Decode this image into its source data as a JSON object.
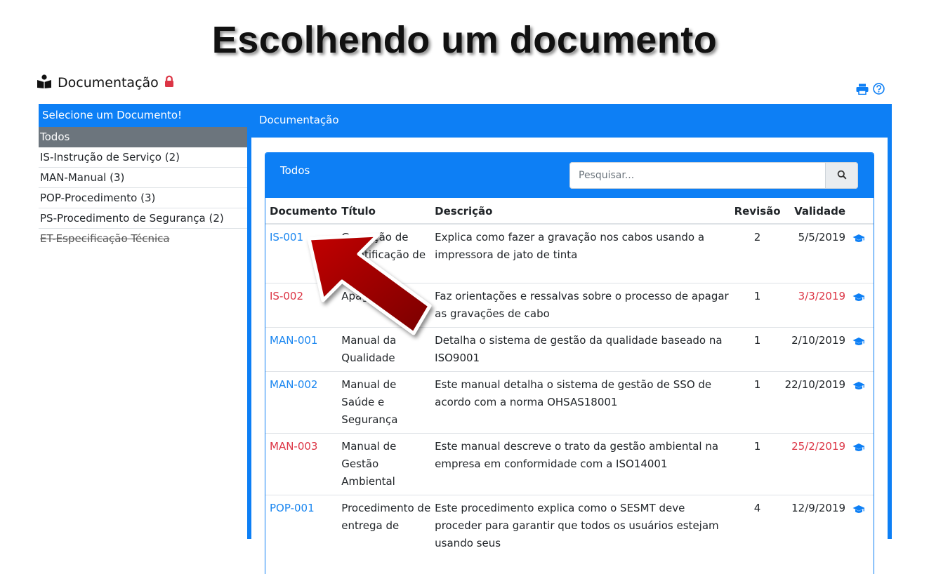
{
  "slide_title": "Escolhendo um documento",
  "page_header": {
    "title": "Documentação",
    "icon": "reader-icon",
    "lock_icon": "lock-icon"
  },
  "tools": {
    "print_icon": "print-icon",
    "help_icon": "help-icon"
  },
  "sidebar": {
    "heading": "Selecione um Documento!",
    "items": [
      {
        "label": "Todos",
        "state": "active"
      },
      {
        "label": "IS-Instrução de Serviço (2)"
      },
      {
        "label": "MAN-Manual (3)"
      },
      {
        "label": "POP-Procedimento (3)"
      },
      {
        "label": "PS-Procedimento de Segurança (2)"
      },
      {
        "label": "ET-Especificação Técnica",
        "state": "strikethrough"
      }
    ]
  },
  "main": {
    "title": "Documentação",
    "sub": {
      "title": "Todos",
      "search": {
        "placeholder": "Pesquisar...",
        "value": ""
      }
    },
    "columns": [
      "Documento",
      "Título",
      "Descrição",
      "Revisão",
      "Validade"
    ],
    "rows": [
      {
        "doc": "IS-001",
        "title": "Gravação de Identificação de",
        "description": "Explica como fazer a gravação nos cabos usando a impressora de jato de tinta",
        "revision": "2",
        "validity": "5/5/2019",
        "expired": false
      },
      {
        "doc": "IS-002",
        "title": "Apagar",
        "description": "Faz orientações e ressalvas sobre o processo de apagar as gravações de cabo",
        "revision": "1",
        "validity": "3/3/2019",
        "expired": true
      },
      {
        "doc": "MAN-001",
        "title": "Manual da Qualidade",
        "description": "Detalha o sistema de gestão da qualidade baseado na ISO9001",
        "revision": "1",
        "validity": "2/10/2019",
        "expired": false
      },
      {
        "doc": "MAN-002",
        "title": "Manual de Saúde e Segurança",
        "description": "Este manual detalha o sistema de gestão de SSO de acordo com a norma OHSAS18001",
        "revision": "1",
        "validity": "22/10/2019",
        "expired": false
      },
      {
        "doc": "MAN-003",
        "title": "Manual de Gestão Ambiental",
        "description": "Este manual descreve o trato da gestão ambiental na empresa em conformidade com a ISO14001",
        "revision": "1",
        "validity": "25/2/2019",
        "expired": true
      },
      {
        "doc": "POP-001",
        "title": "Procedimento de entrega de",
        "description": "Este procedimento explica como o SESMT deve proceder para garantir que todos os usuários estejam usando seus",
        "revision": "4",
        "validity": "12/9/2019",
        "expired": false
      }
    ],
    "row_action_icon": "graduation-cap-icon"
  },
  "colors": {
    "primary": "#0d7ff5",
    "link": "#1a86f0",
    "danger": "#dc3545",
    "sidebar_active": "#6c757d",
    "arrow": "#a50000"
  }
}
